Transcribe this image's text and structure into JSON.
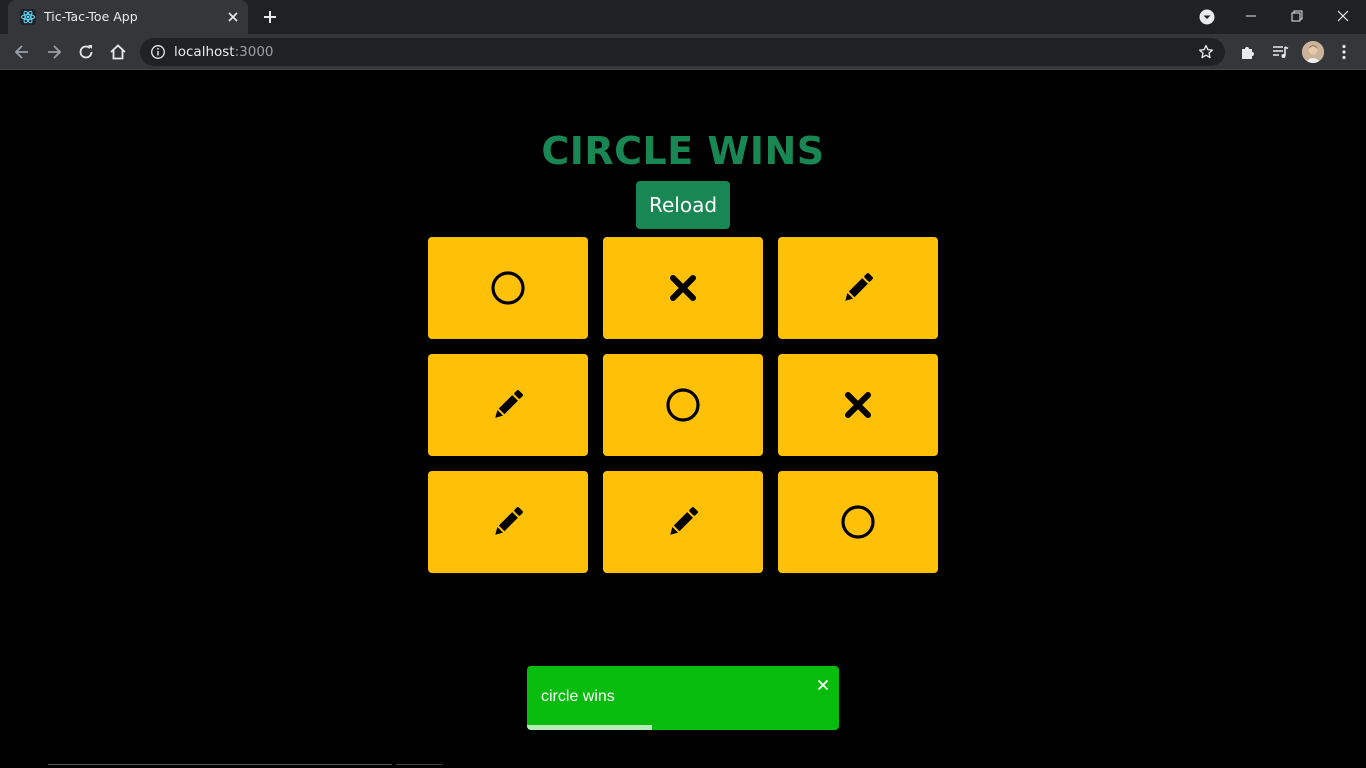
{
  "browser": {
    "tab_title": "Tic-Tac-Toe App",
    "url_host": "localhost",
    "url_port": ":3000"
  },
  "game": {
    "status": "CIRCLE WINS",
    "reload_label": "Reload",
    "colors": {
      "success": "#198754",
      "cell": "#ffc107",
      "toast": "#07bc0c"
    },
    "board": [
      [
        "circle",
        "cross",
        "pen"
      ],
      [
        "pen",
        "circle",
        "cross"
      ],
      [
        "pen",
        "pen",
        "circle"
      ]
    ]
  },
  "toast": {
    "message": "circle wins",
    "progress": 0.4
  }
}
